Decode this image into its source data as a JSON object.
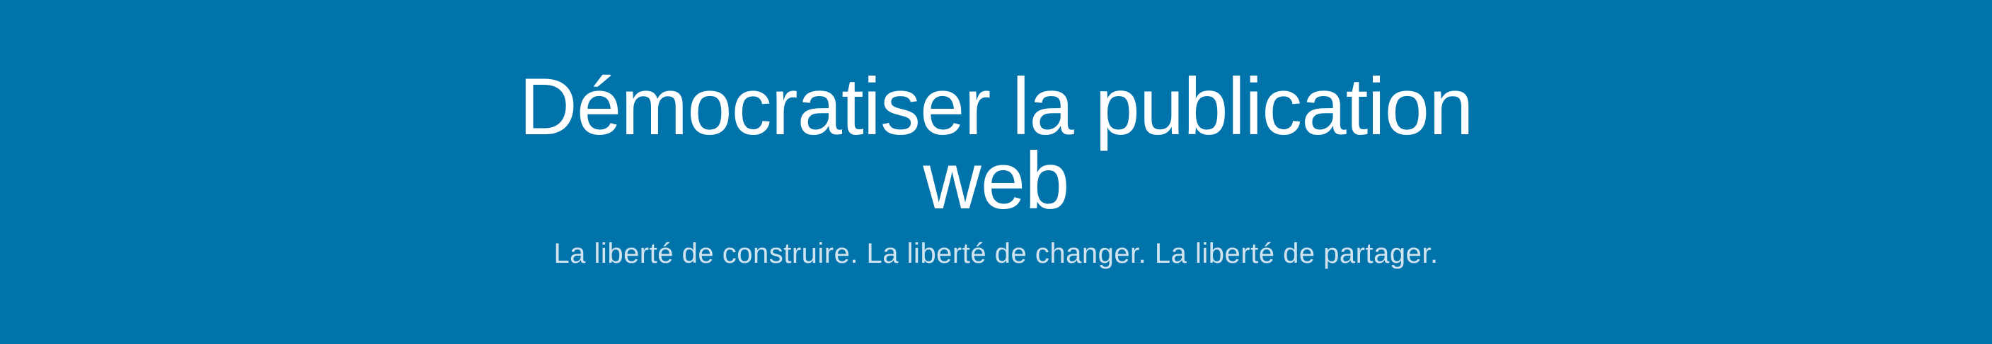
{
  "hero": {
    "title_line1": "Démocratiser la publication",
    "title_line2": "web",
    "tagline": "La liberté de construire. La liberté de changer. La liberté de partager."
  },
  "colors": {
    "background": "#0073aa",
    "title": "#ffffff",
    "tagline": "#d0e3ef"
  }
}
